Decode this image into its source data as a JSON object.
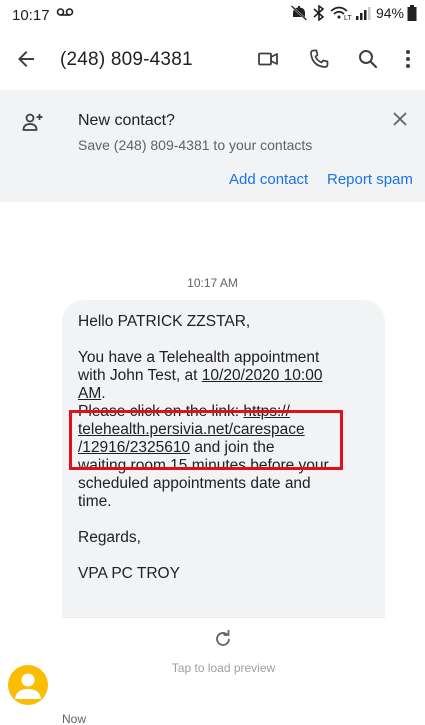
{
  "status_bar": {
    "time": "10:17",
    "battery": "94%"
  },
  "app_bar": {
    "title": "(248) 809-4381"
  },
  "banner": {
    "title": "New contact?",
    "subtitle": "Save (248) 809-4381 to your contacts",
    "add_contact": "Add contact",
    "report_spam": "Report spam"
  },
  "conversation": {
    "timestamp": "10:17 AM",
    "message": {
      "greeting": "Hello PATRICK ZZSTAR,",
      "line1_a": "You have a Telehealth appointment",
      "line1_b": "with John Test, at ",
      "appointment_date": "10/20/2020 10:00",
      "line1_c": "AM",
      "line1_c_end": ".",
      "link_prefix": "Please click on the link: ",
      "link_part1": "https://",
      "link_part2": "telehealth.persivia.net/carespace",
      "link_part3": "/12916/2325610",
      "after_link_a": " and join the",
      "after_link_b": "waiting room 15 minutes before your",
      "after_link_c": "scheduled appointments date and",
      "after_link_d": "time.",
      "regards": "Regards,",
      "signature": "VPA PC TROY"
    },
    "link_preview": {
      "label": "Tap to load preview"
    },
    "sent_time": "Now"
  },
  "colors": {
    "accent": "#1a73e8",
    "highlight": "#e3101c",
    "avatar": "#fbbc04",
    "bubble": "#f1f3f4"
  },
  "icons": [
    "voicemail-icon",
    "mute-icon",
    "bluetooth-icon",
    "signal-icon",
    "battery-icon",
    "back-arrow-icon",
    "video-call-icon",
    "phone-icon",
    "search-icon",
    "more-vert-icon",
    "person-add-icon",
    "close-icon",
    "refresh-icon",
    "avatar-person-icon"
  ]
}
